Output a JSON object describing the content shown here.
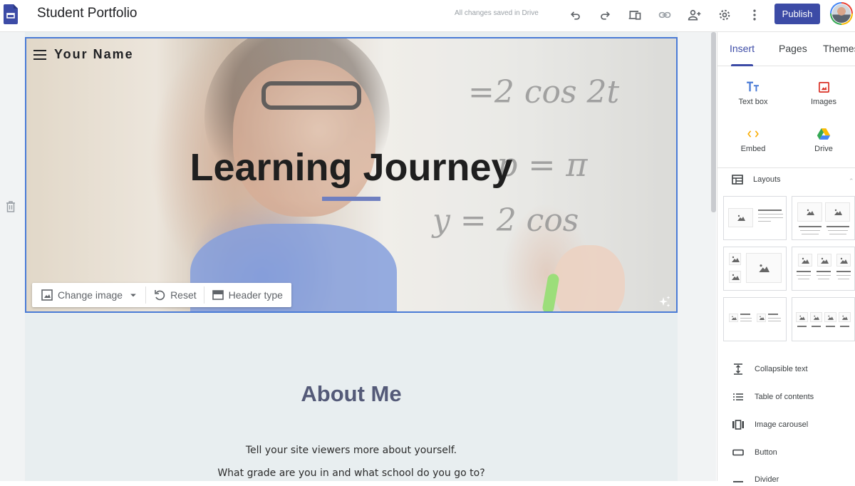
{
  "app": {
    "title": "Student Portfolio",
    "save_status": "All changes saved in Drive",
    "publish_label": "Publish",
    "toolbar_icons": [
      "undo-icon",
      "redo-icon",
      "preview-icon",
      "link-icon",
      "share-icon",
      "settings-icon",
      "more-vert-icon"
    ]
  },
  "hero": {
    "site_name": "Your Name",
    "title": "Learning Journey",
    "math_lines": [
      "=2 cos 2t",
      "p = π",
      "y = 2 cos"
    ],
    "toolbar": {
      "change_image": "Change image",
      "reset": "Reset",
      "header_type": "Header type"
    }
  },
  "about": {
    "title": "About Me",
    "p1": "Tell your site viewers more about yourself.",
    "p2": "What grade are you in and what school do you go to?"
  },
  "panel": {
    "tabs": [
      {
        "label": "Insert",
        "active": true
      },
      {
        "label": "Pages",
        "active": false
      },
      {
        "label": "Themes",
        "active": false
      }
    ],
    "insert_items": [
      {
        "label": "Text box",
        "icon": "text-box-icon"
      },
      {
        "label": "Images",
        "icon": "image-icon"
      },
      {
        "label": "Embed",
        "icon": "embed-icon"
      },
      {
        "label": "Drive",
        "icon": "drive-icon"
      }
    ],
    "layouts_label": "Layouts",
    "list_items": [
      {
        "label": "Collapsible text",
        "icon": "collapsible-text-icon"
      },
      {
        "label": "Table of contents",
        "icon": "toc-icon"
      },
      {
        "label": "Image carousel",
        "icon": "carousel-icon"
      },
      {
        "label": "Button",
        "icon": "button-icon"
      },
      {
        "label": "Divider",
        "icon": "divider-icon"
      }
    ]
  },
  "colors": {
    "accent": "#3c4ba6",
    "selection_border": "#4a7bd6",
    "about_title": "#545a78",
    "hero_underline": "#6f7fc0"
  }
}
